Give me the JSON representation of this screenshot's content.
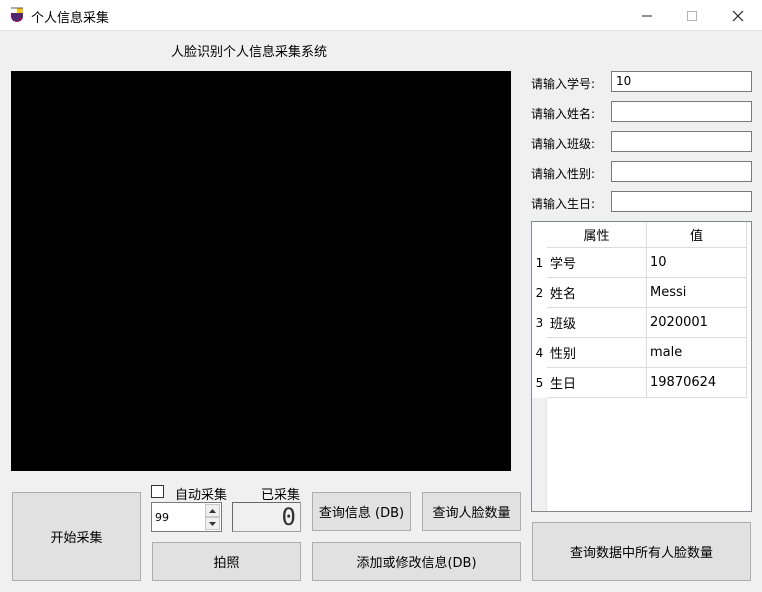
{
  "window": {
    "title": "个人信息采集",
    "icon": "barcelona-crest-icon"
  },
  "heading": "人脸识别个人信息采集系统",
  "form": {
    "fields": [
      {
        "label": "请输入学号:",
        "value": "10"
      },
      {
        "label": "请输入姓名:",
        "value": ""
      },
      {
        "label": "请输入班级:",
        "value": ""
      },
      {
        "label": "请输入性别:",
        "value": ""
      },
      {
        "label": "请输入生日:",
        "value": ""
      }
    ]
  },
  "table": {
    "headers": [
      "属性",
      "值"
    ],
    "rows": [
      {
        "num": "1",
        "attr": "学号",
        "value": "10"
      },
      {
        "num": "2",
        "attr": "姓名",
        "value": "Messi"
      },
      {
        "num": "3",
        "attr": "班级",
        "value": "2020001"
      },
      {
        "num": "4",
        "attr": "性别",
        "value": "male"
      },
      {
        "num": "5",
        "attr": "生日",
        "value": "19870624"
      }
    ]
  },
  "controls": {
    "start_button": "开始采集",
    "auto_collect_label": "自动采集",
    "auto_collect_checked": false,
    "collected_label": "已采集",
    "spin_value": "99",
    "collected_count": "0",
    "photo_button": "拍照",
    "query_info_button": "查询信息 (DB)",
    "query_face_button": "查询人脸数量",
    "add_modify_button": "添加或修改信息(DB)",
    "query_all_button": "查询数据中所有人脸数量"
  }
}
